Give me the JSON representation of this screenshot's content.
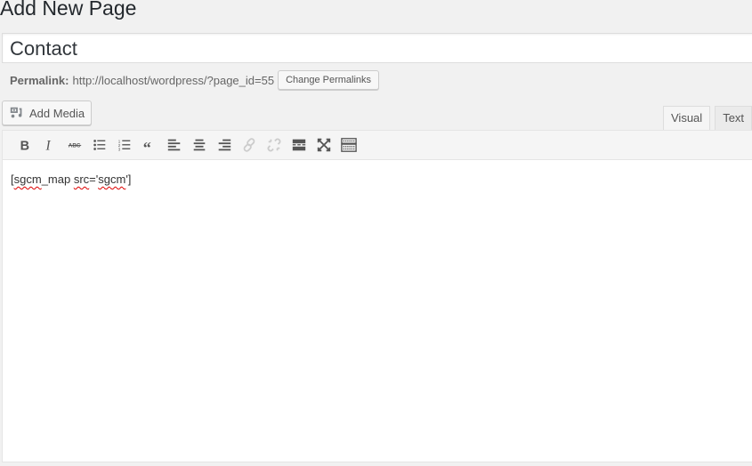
{
  "page": {
    "title": "Add New Page"
  },
  "post_title": {
    "value": "Contact"
  },
  "permalink": {
    "label": "Permalink:",
    "url": "http://localhost/wordpress/?page_id=55",
    "change_button": "Change Permalinks"
  },
  "media": {
    "add_media_label": "Add Media",
    "icon": "media-icon"
  },
  "editor_tabs": [
    {
      "label": "Visual",
      "active": true
    },
    {
      "label": "Text",
      "active": false
    }
  ],
  "toolbar": {
    "buttons": [
      {
        "name": "bold",
        "icon": "bold-icon"
      },
      {
        "name": "italic",
        "icon": "italic-icon"
      },
      {
        "name": "strikethrough",
        "icon": "strikethrough-icon"
      },
      {
        "name": "bulleted-list",
        "icon": "bulleted-list-icon"
      },
      {
        "name": "numbered-list",
        "icon": "numbered-list-icon"
      },
      {
        "name": "blockquote",
        "icon": "blockquote-icon"
      },
      {
        "name": "align-left",
        "icon": "align-left-icon"
      },
      {
        "name": "align-center",
        "icon": "align-center-icon"
      },
      {
        "name": "align-right",
        "icon": "align-right-icon"
      },
      {
        "name": "insert-link",
        "icon": "link-icon",
        "disabled": true
      },
      {
        "name": "remove-link",
        "icon": "unlink-icon",
        "disabled": true
      },
      {
        "name": "read-more",
        "icon": "read-more-icon"
      },
      {
        "name": "fullscreen",
        "icon": "fullscreen-icon"
      },
      {
        "name": "toolbar-toggle",
        "icon": "keyboard-icon"
      }
    ]
  },
  "editor": {
    "content_parts": [
      "[",
      "sgcm",
      "_map ",
      "src",
      "='",
      "sgcm",
      "']"
    ]
  }
}
